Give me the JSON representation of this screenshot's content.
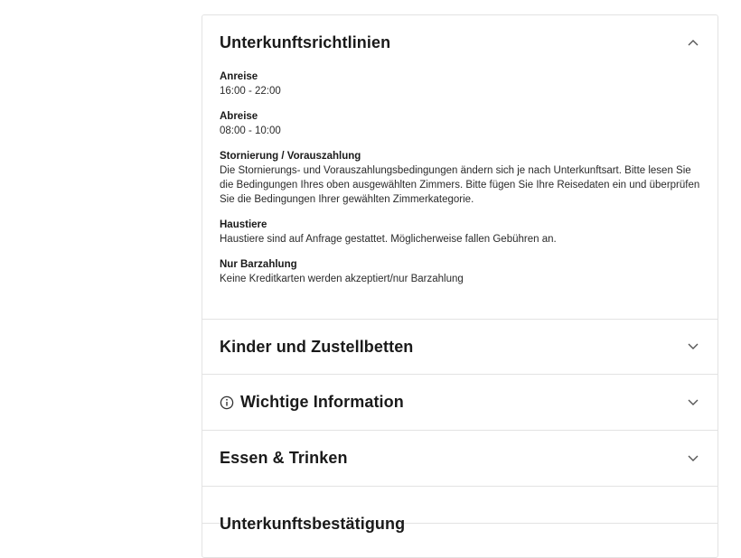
{
  "sections": {
    "policies": {
      "title": "Unterkunftsrichtlinien",
      "items": [
        {
          "label": "Anreise",
          "text": "16:00 - 22:00"
        },
        {
          "label": "Abreise",
          "text": "08:00 - 10:00"
        },
        {
          "label": "Stornierung / Vorauszahlung",
          "text": "Die Stornierungs- und Vorauszahlungsbedingungen ändern sich je nach Unterkunftsart. Bitte lesen Sie die Bedingungen Ihres oben ausgewählten Zimmers. Bitte fügen Sie Ihre Reisedaten ein und überprüfen Sie die Bedingungen Ihrer gewählten Zimmerkategorie."
        },
        {
          "label": "Haustiere",
          "text": "Haustiere sind auf Anfrage gestattet. Möglicherweise fallen Gebühren an."
        },
        {
          "label": "Nur Barzahlung",
          "text": "Keine Kreditkarten werden akzeptiert/nur Barzahlung"
        }
      ],
      "expanded": true
    },
    "children": {
      "title": "Kinder und Zustellbetten",
      "expanded": false
    },
    "important": {
      "title": "Wichtige Information",
      "icon": "info-circle-icon",
      "expanded": false
    },
    "food": {
      "title": "Essen & Trinken",
      "expanded": false
    },
    "next": {
      "title": "Unterkunftsbestätigung",
      "expanded": false
    }
  },
  "icons": {
    "expanded": "chevron-up-icon",
    "collapsed": "chevron-down-icon"
  },
  "colors": {
    "text": "#1a1a1a",
    "border": "#e3e3e3",
    "icon": "#555555"
  }
}
